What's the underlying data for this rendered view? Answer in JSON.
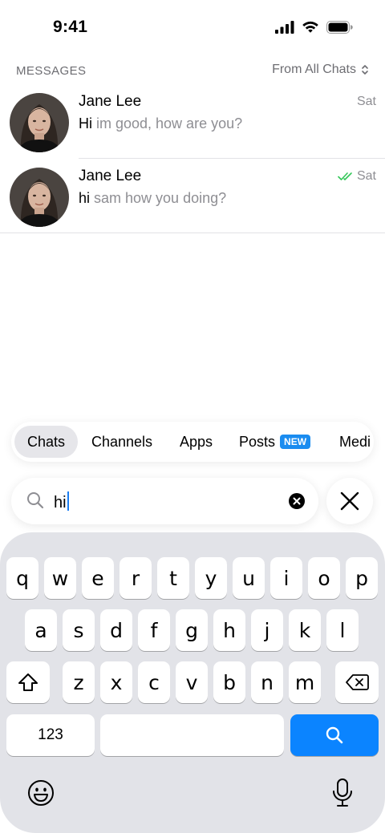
{
  "status_bar": {
    "time": "9:41",
    "icons": [
      "cellular-signal-icon",
      "wifi-icon",
      "battery-icon"
    ]
  },
  "messages_section": {
    "title": "MESSAGES",
    "filter_label": "From All Chats",
    "filter_icon": "chevron-up-down-icon"
  },
  "chats": [
    {
      "name": "Jane Lee",
      "preview_match": "Hi",
      "preview_rest": " im good, how are you?",
      "date": "Sat",
      "read_receipt": false
    },
    {
      "name": "Jane Lee",
      "preview_match": "hi",
      "preview_rest": " sam how you doing?",
      "date": "Sat",
      "read_receipt": true
    }
  ],
  "tabs": [
    {
      "label": "Chats",
      "active": true
    },
    {
      "label": "Channels",
      "active": false
    },
    {
      "label": "Apps",
      "active": false
    },
    {
      "label": "Posts",
      "active": false,
      "badge": "NEW"
    },
    {
      "label": "Medi",
      "active": false
    }
  ],
  "search": {
    "value": "hi",
    "icons": [
      "search-icon",
      "clear-icon",
      "close-icon"
    ]
  },
  "keyboard": {
    "row1": [
      "q",
      "w",
      "e",
      "r",
      "t",
      "y",
      "u",
      "i",
      "o",
      "p"
    ],
    "row2": [
      "a",
      "s",
      "d",
      "f",
      "g",
      "h",
      "j",
      "k",
      "l"
    ],
    "row3": [
      "z",
      "x",
      "c",
      "v",
      "b",
      "n",
      "m"
    ],
    "numbers_label": "123",
    "icons": [
      "shift-icon",
      "backspace-icon",
      "search-key-icon",
      "emoji-icon",
      "microphone-icon"
    ]
  },
  "colors": {
    "accent": "#0b84ff",
    "badge": "#1a8cf0",
    "read_check": "#34c759",
    "secondary_text": "#8e8e93",
    "keyboard_bg": "#e2e3e8"
  }
}
